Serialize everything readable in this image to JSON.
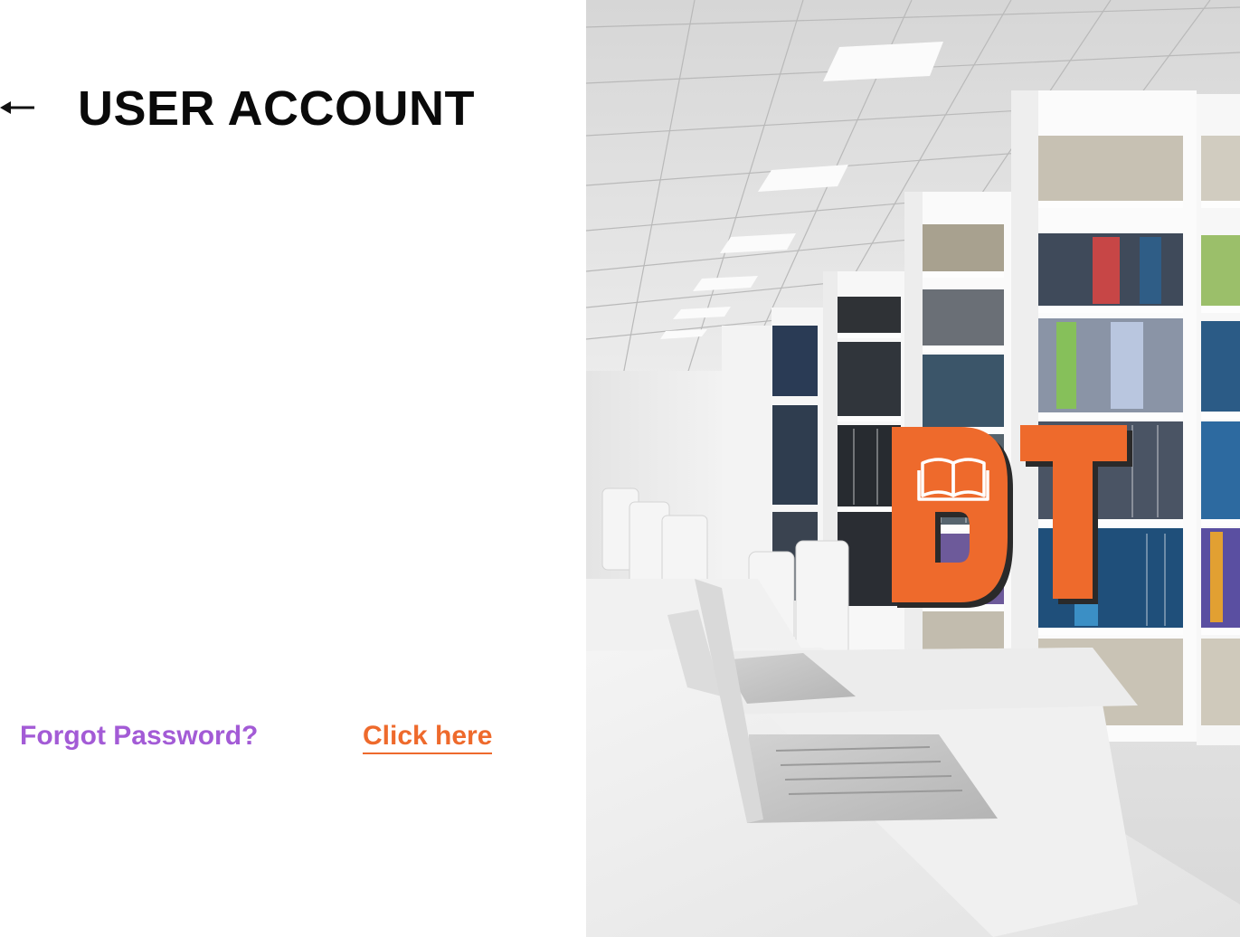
{
  "header": {
    "back_icon": "arrow-left-icon",
    "title": "USER ACCOUNT"
  },
  "login": {
    "forgot_label": "Forgot Password?",
    "click_here_label": "Click here"
  },
  "hero": {
    "image_subject": "library interior with bookshelves and laptops",
    "logo_icon": "open-book-icon"
  },
  "colors": {
    "title": "#0a0a0a",
    "forgot_label": "#a35bd6",
    "link_accent": "#ee6a2c",
    "logo_shadow": "#2a2a2a"
  }
}
